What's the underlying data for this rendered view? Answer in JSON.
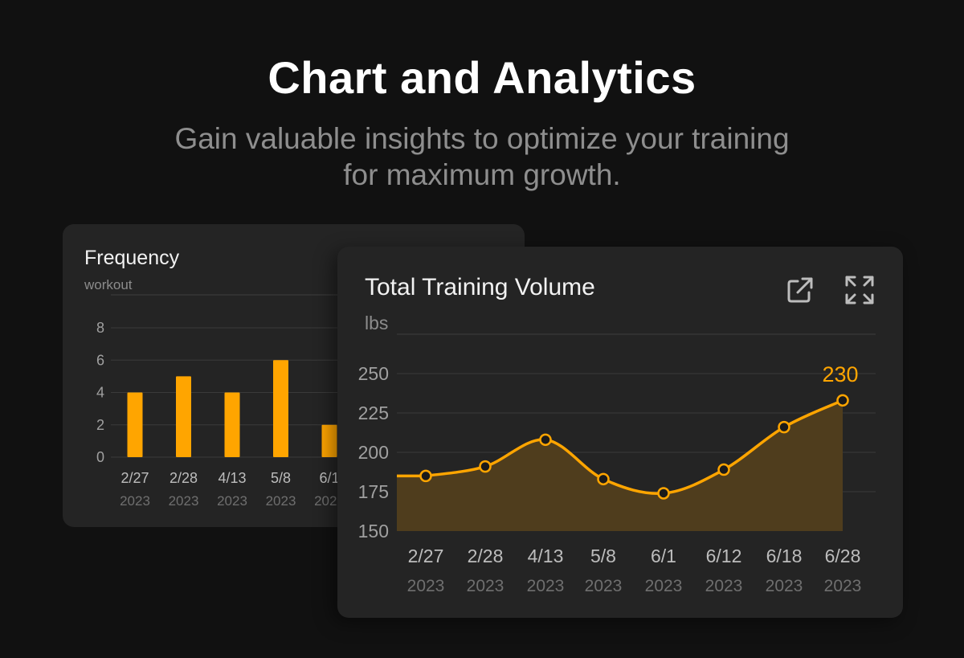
{
  "hero": {
    "title": "Chart and Analytics",
    "subtitle_line1": "Gain valuable insights to optimize your training",
    "subtitle_line2": "for maximum growth."
  },
  "colors": {
    "background": "#111111",
    "card": "#242424",
    "accent": "#FFA500",
    "area_fill": "#4f3d1d",
    "muted_text": "#8e8e8e"
  },
  "frequency_card": {
    "title": "Frequency",
    "unit": "workout"
  },
  "volume_card": {
    "title": "Total Training Volume",
    "unit": "lbs",
    "share_icon": "share-external-icon",
    "expand_icon": "expand-fullscreen-icon"
  },
  "chart_data": [
    {
      "type": "bar",
      "title": "Frequency",
      "ylabel": "workout",
      "categories": [
        "2/27",
        "2/28",
        "4/13",
        "5/8",
        "6/1"
      ],
      "category_years": [
        "2023",
        "2023",
        "2023",
        "2023",
        "2023"
      ],
      "values": [
        4,
        5,
        4,
        6,
        2
      ],
      "ylim": [
        0,
        8
      ],
      "yticks": [
        0,
        2,
        4,
        6,
        8
      ],
      "grid": true,
      "color": "#FFA500"
    },
    {
      "type": "area",
      "title": "Total Training Volume",
      "ylabel": "lbs",
      "categories": [
        "2/27",
        "2/28",
        "4/13",
        "5/8",
        "6/1",
        "6/12",
        "6/18",
        "6/28"
      ],
      "category_years": [
        "2023",
        "2023",
        "2023",
        "2023",
        "2023",
        "2023",
        "2023",
        "2023"
      ],
      "values": [
        185,
        191,
        208,
        183,
        174,
        189,
        216,
        233
      ],
      "ylim": [
        150,
        260
      ],
      "yticks": [
        150,
        175,
        200,
        225,
        250
      ],
      "annotation": "230",
      "grid": true,
      "color": "#FFA500"
    }
  ]
}
